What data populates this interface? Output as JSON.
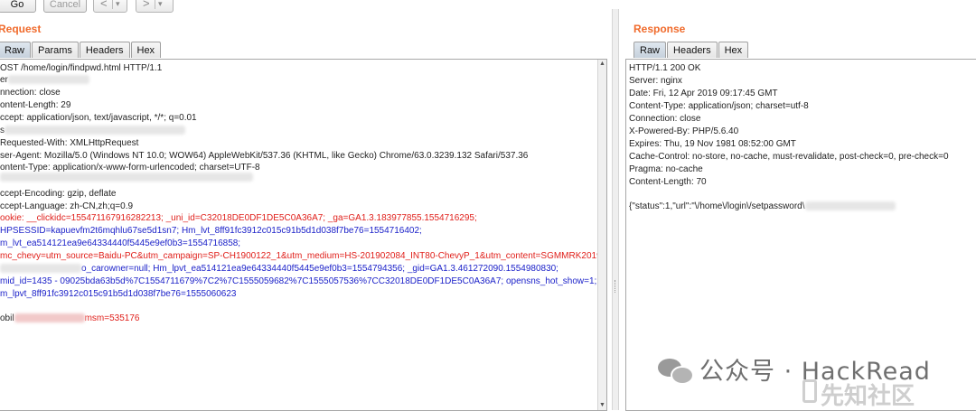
{
  "toolbar": {
    "go": "Go",
    "cancel": "Cancel",
    "back": "<",
    "forward": ">",
    "dropdown": "▾"
  },
  "request": {
    "title": "Request",
    "tabs": [
      "Raw",
      "Params",
      "Headers",
      "Hex"
    ],
    "active_tab": "Raw",
    "lines": [
      "OST /home/login/findpwd.html HTTP/1.1",
      "er",
      "nnection: close",
      "ontent-Length: 29",
      "ccept: application/json, text/javascript, */*; q=0.01",
      "s",
      "Requested-With: XMLHttpRequest",
      "ser-Agent: Mozilla/5.0 (Windows NT 10.0; WOW64) AppleWebKit/537.36 (KHTML, like Gecko) Chrome/63.0.3239.132 Safari/537.36",
      "ontent-Type: application/x-www-form-urlencoded; charset=UTF-8",
      "",
      "ccept-Encoding: gzip, deflate",
      "ccept-Language: zh-CN,zh;q=0.9",
      "ookie: __clickidc=155471167916282213; _uni_id=C32018DE0DF1DE5C0A36A7; _ga=GA1.3.183977855.1554716295;",
      "HPSESSID=kapuevfm2t6mqhlu67se5d1sn7; Hm_lvt_8ff91fc3912c015c91b5d1d038f7be76=1554716402;",
      "m_lvt_ea514121ea9e64334440f5445e9ef0b3=1554716858;",
      "mc_chevy=utm_source=Baidu-PC&utm_campaign=SP-CH1900122_1&utm_medium=HS-201902084_INT80-ChevyP_1&utm_content=SGMMRK2019000011;",
      "o_carowner=null; Hm_lpvt_ea514121ea9e64334440f5445e9ef0b3=1554794356; _gid=GA1.3.461272090.1554980830;",
      "mid_id=1435 - 09025bda63b5d%7C1554711679%7C2%7C1555059682%7C1555057536%7CC32018DE0DF1DE5C0A36A7; opensns_hot_show=1;",
      "m_lpvt_8ff91fc3912c015c91b5d1d038f7be76=1555060623",
      "",
      "obil",
      "msm=535176"
    ]
  },
  "response": {
    "title": "Response",
    "tabs": [
      "Raw",
      "Headers",
      "Hex"
    ],
    "active_tab": "Raw",
    "lines": [
      "HTTP/1.1 200 OK",
      "Server: nginx",
      "Date: Fri, 12 Apr 2019 09:17:45 GMT",
      "Content-Type: application/json; charset=utf-8",
      "Connection: close",
      "X-Powered-By: PHP/5.6.40",
      "Expires: Thu, 19 Nov 1981 08:52:00 GMT",
      "Cache-Control: no-store, no-cache, must-revalidate, post-check=0, pre-check=0",
      "Pragma: no-cache",
      "Content-Length: 70",
      "",
      "{\"status\":1,\"url\":\"\\/home\\/login\\/setpassword\\"
    ]
  },
  "watermark": {
    "text": "公众号 · HackRead",
    "sub": "先知社区"
  },
  "colors": {
    "title": "#f06a2b",
    "header_name": "#1f1f1f",
    "cookie_value": "#1c22c9",
    "cookie_name": "#e0201b"
  }
}
